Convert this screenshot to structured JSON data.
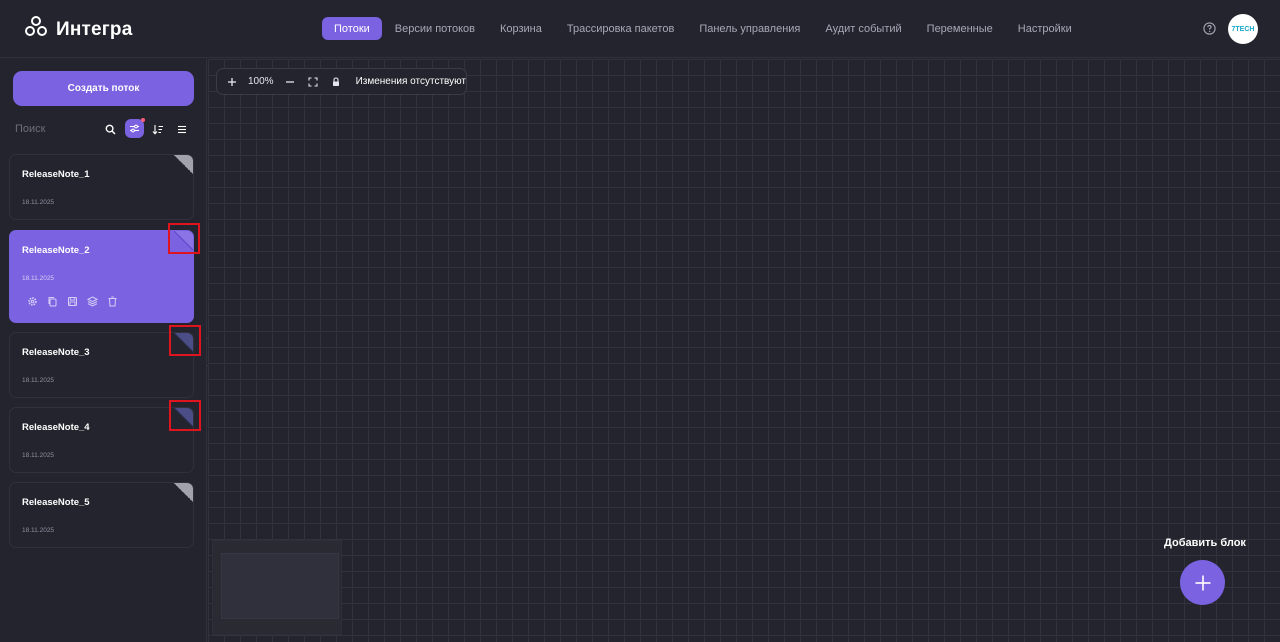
{
  "app": {
    "logo_text": "Интегра"
  },
  "nav": {
    "tabs": [
      {
        "label": "Потоки",
        "active": true
      },
      {
        "label": "Версии потоков"
      },
      {
        "label": "Корзина"
      },
      {
        "label": "Трассировка пакетов"
      },
      {
        "label": "Панель управления"
      },
      {
        "label": "Аудит событий"
      },
      {
        "label": "Переменные"
      },
      {
        "label": "Настройки"
      }
    ]
  },
  "user": {
    "avatar_text": "7TECH"
  },
  "sidebar": {
    "create_label": "Создать поток",
    "search_placeholder": "Поиск",
    "flows": [
      {
        "title": "ReleaseNote_1",
        "date": "18.11.2025",
        "corner": "grey"
      },
      {
        "title": "ReleaseNote_2",
        "date": "18.11.2025",
        "corner": "purple",
        "active": true
      },
      {
        "title": "ReleaseNote_3",
        "date": "18.11.2025",
        "corner": "navy"
      },
      {
        "title": "ReleaseNote_4",
        "date": "18.11.2025",
        "corner": "navy"
      },
      {
        "title": "ReleaseNote_5",
        "date": "18.11.2025",
        "corner": "grey"
      }
    ]
  },
  "canvas": {
    "zoom": "100%",
    "status": "Изменения отсутствуют",
    "add_block_label": "Добавить блок"
  },
  "colors": {
    "accent": "#7a62e0",
    "background": "#23242d",
    "highlight": "#e0141e"
  }
}
